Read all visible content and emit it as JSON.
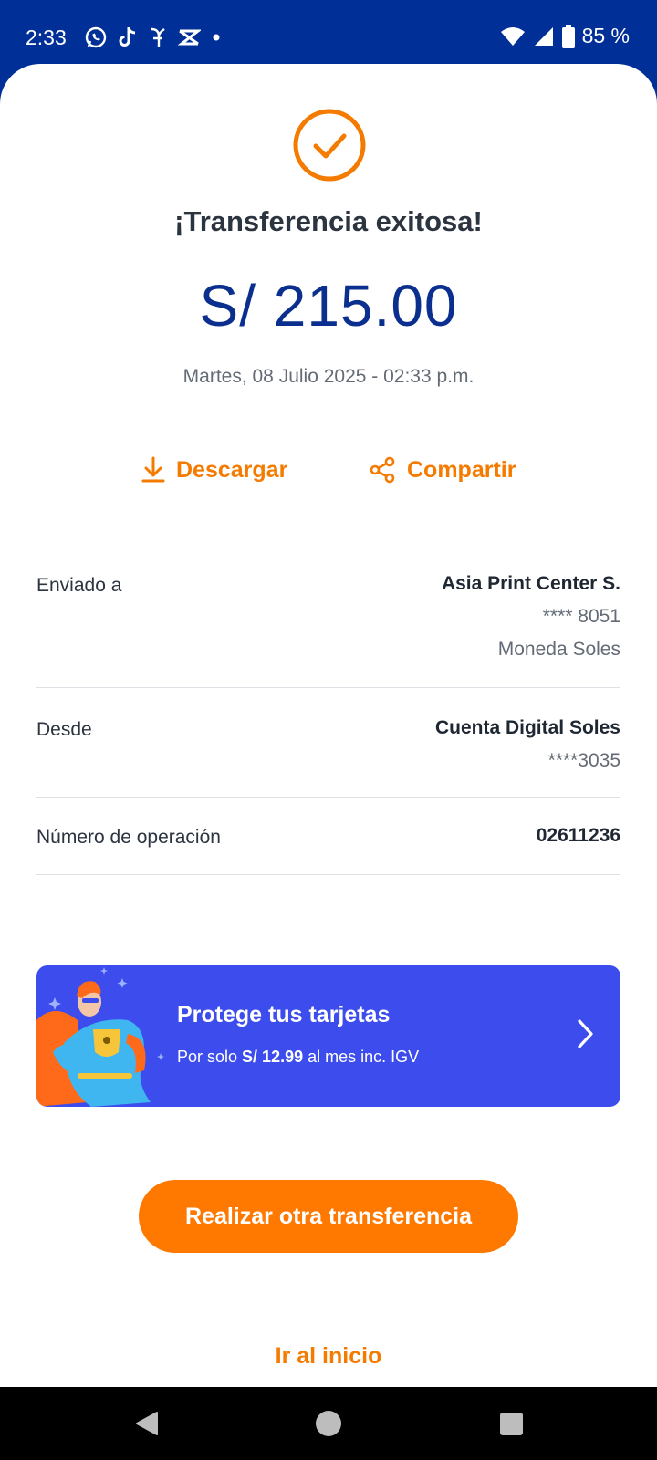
{
  "status_bar": {
    "time": "2:33",
    "battery": "85 %",
    "notification_icons": [
      "whatsapp-icon",
      "tiktok-icon",
      "y-app-icon",
      "capcut-icon",
      "dot-icon"
    ]
  },
  "receipt": {
    "title": "¡Transferencia exitosa!",
    "amount": "S/ 215.00",
    "datetime": "Martes, 08 Julio 2025 - 02:33 p.m.",
    "download_label": "Descargar",
    "share_label": "Compartir"
  },
  "details": {
    "sent_to": {
      "label": "Enviado a",
      "name": "Asia Print Center S.",
      "account": "**** 8051",
      "currency": "Moneda Soles"
    },
    "from": {
      "label": "Desde",
      "name": "Cuenta Digital Soles",
      "account": "****3035"
    },
    "operation": {
      "label": "Número de operación",
      "value": "02611236"
    }
  },
  "promo": {
    "title": "Protege tus tarjetas",
    "sub_prefix": "Por solo ",
    "sub_price": "S/ 12.99",
    "sub_suffix": " al mes inc. IGV"
  },
  "actions": {
    "primary": "Realizar otra transferencia",
    "home": "Ir al inicio"
  },
  "colors": {
    "brand_blue": "#002f97",
    "accent_orange": "#ff7800",
    "promo_blue": "#3c4ced"
  }
}
